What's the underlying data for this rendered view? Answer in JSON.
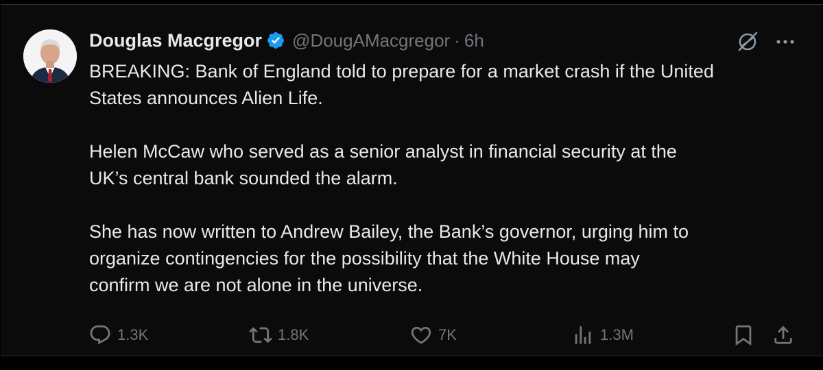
{
  "author": {
    "name": "Douglas Macgregor",
    "handle": "@DougAMacgregor",
    "separator": "·",
    "time": "6h",
    "verified_color": "#1d9bf0"
  },
  "icons": {
    "grok": "grok-icon",
    "more": "more-icon",
    "reply": "reply-icon",
    "repost": "repost-icon",
    "like": "heart-icon",
    "views": "views-icon",
    "bookmark": "bookmark-icon",
    "share": "share-icon"
  },
  "body": {
    "paragraphs": [
      "BREAKING: Bank of England told to prepare for a market crash if the United\nStates announces Alien Life.",
      "Helen McCaw who served as a senior analyst in financial security at the\nUK’s central bank sounded the alarm.",
      "She has now written to Andrew Bailey, the Bank’s governor, urging him to\norganize contingencies for the possibility that the White House may\nconfirm we are not alone in the universe."
    ]
  },
  "stats": {
    "replies": "1.3K",
    "reposts": "1.8K",
    "likes": "7K",
    "views": "1.3M"
  },
  "colors": {
    "background": "#000000",
    "text": "#e7e9ea",
    "muted": "#71767b",
    "accent": "#1d9bf0"
  }
}
